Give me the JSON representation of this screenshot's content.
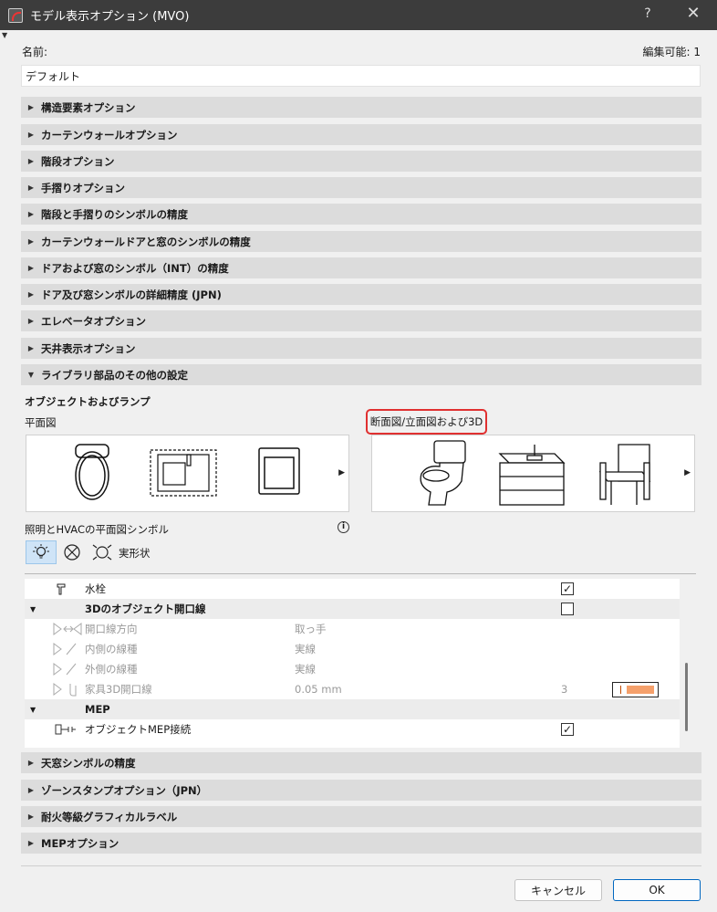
{
  "window": {
    "title": "モデル表示オプション (MVO)",
    "help": "?",
    "close": "✕"
  },
  "header": {
    "name_label": "名前:",
    "editable_label": "編集可能: 1",
    "name_value": "デフォルト"
  },
  "sections_top": [
    "構造要素オプション",
    "カーテンウォールオプション",
    "階段オプション",
    "手摺りオプション",
    "階段と手摺りのシンボルの精度",
    "カーテンウォールドアと窓のシンボルの精度",
    "ドアおよび窓のシンボル（INT）の精度",
    "ドア及び窓シンボルの詳細精度 (JPN)",
    "エレベータオプション",
    "天井表示オプション",
    "ライブラリ部品のその他の設定"
  ],
  "library": {
    "subtitle": "オブジェクトおよびランプ",
    "plan_label": "平面図",
    "section_label": "断面図/立面図および3D",
    "lighting_label": "照明とHVACの平面図シンボル",
    "shape_label": "実形状"
  },
  "table": {
    "rows": [
      {
        "name": "水栓",
        "checked": "✓"
      },
      {
        "group": "3Dのオブジェクト開口線",
        "checked": ""
      },
      {
        "name": "開口線方向",
        "value": "取っ手"
      },
      {
        "name": "内側の線種",
        "value": "実線"
      },
      {
        "name": "外側の線種",
        "value": "実線"
      },
      {
        "name": "家具3D開口線",
        "value": "0.05 mm",
        "num": "3"
      },
      {
        "group": "MEP"
      },
      {
        "name": "オブジェクトMEP接続",
        "checked": "✓"
      }
    ]
  },
  "sections_bottom": [
    "天窓シンボルの精度",
    "ゾーンスタンプオプション（JPN）",
    "耐火等級グラフィカルラベル",
    "MEPオプション"
  ],
  "buttons": {
    "cancel": "キャンセル",
    "ok": "OK"
  },
  "colors": {
    "titlebar": "#3c3c3c",
    "section": "#dcdcdc",
    "highlight": "#e03030",
    "accent": "#0067c0"
  }
}
